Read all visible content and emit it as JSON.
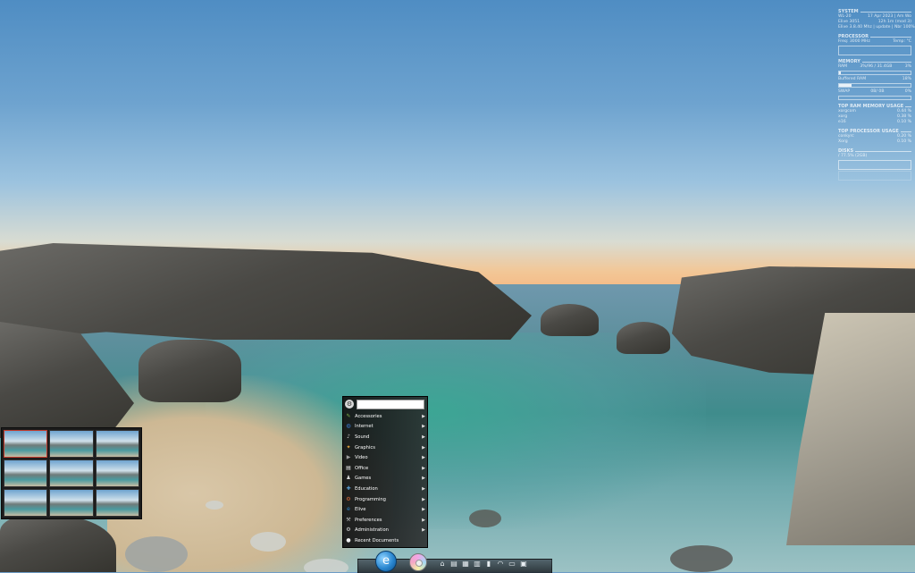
{
  "conky": {
    "system": {
      "title": "SYSTEM",
      "host": "WL-20",
      "date": "17 Apr 2023 | Am Wo",
      "kernel": "Elive 3051",
      "uptime": "12h 1m (mod 3)",
      "cpu_info": "Elive 3.8.40 Mhz | update | Nbr 100%"
    },
    "processor": {
      "title": "PROCESSOR",
      "freq": "Freq: 3000 MHz",
      "temp": "Temp: °C"
    },
    "memory": {
      "title": "MEMORY",
      "ram": "RAM",
      "ram_value": "3%/96 / 31.4GB",
      "ram_pct": "3%",
      "ram_fill": 0.03,
      "buffered": "Buffered RAM",
      "buffered_pct": "18%",
      "buffered_fill": 0.18,
      "swap": "SWAP",
      "swap_value": "0B/ 0B",
      "swap_pct": "0%",
      "swap_fill": 0
    },
    "top_mem": {
      "title": "TOP RAM MEMORY USAGE",
      "rows": [
        {
          "name": "xorgcom",
          "value": "0.44 %"
        },
        {
          "name": "xorg",
          "value": "0.38 %"
        },
        {
          "name": "e16",
          "value": "0.10 %"
        }
      ]
    },
    "top_cpu": {
      "title": "TOP PROCESSOR USAGE",
      "rows": [
        {
          "name": "conkyrc",
          "value": "0.20 %"
        },
        {
          "name": "Xorg",
          "value": "0.10 %"
        }
      ]
    },
    "disks": {
      "title": "DISKS",
      "root": "/ 77.5% (2GB)"
    }
  },
  "menu": {
    "search_placeholder": "",
    "items": [
      {
        "label": "Accessories",
        "icon": "accessories-icon",
        "glyph": "✎",
        "color": "#7fb24a"
      },
      {
        "label": "Internet",
        "icon": "internet-globe-icon",
        "glyph": "◍",
        "color": "#3a7bd5"
      },
      {
        "label": "Sound",
        "icon": "sound-icon",
        "glyph": "♪",
        "color": "#c9c9c9"
      },
      {
        "label": "Graphics",
        "icon": "graphics-icon",
        "glyph": "✦",
        "color": "#e0a13a"
      },
      {
        "label": "Video",
        "icon": "video-icon",
        "glyph": "▶",
        "color": "#9a9a9a"
      },
      {
        "label": "Office",
        "icon": "office-icon",
        "glyph": "▤",
        "color": "#e8e8e8"
      },
      {
        "label": "Games",
        "icon": "games-icon",
        "glyph": "♟",
        "color": "#d8d8d8"
      },
      {
        "label": "Education",
        "icon": "education-icon",
        "glyph": "✚",
        "color": "#5aa0d8"
      },
      {
        "label": "Programming",
        "icon": "programming-icon",
        "glyph": "⚙",
        "color": "#d86a3a"
      },
      {
        "label": "Elive",
        "icon": "elive-icon",
        "glyph": "e",
        "color": "#2a87d0"
      },
      {
        "label": "Preferences",
        "icon": "preferences-icon",
        "glyph": "⚒",
        "color": "#bdbdbd"
      },
      {
        "label": "Administration",
        "icon": "administration-icon",
        "glyph": "⚙",
        "color": "#dcdcdc"
      },
      {
        "label": "Recent Documents",
        "icon": "recent-documents-icon",
        "glyph": "●",
        "color": "#eeeeee"
      }
    ]
  },
  "pager": {
    "workspaces": 9,
    "active": 0
  },
  "dock": {
    "launcher_glyph": "e",
    "icons": [
      {
        "name": "home-folder-icon",
        "glyph": "⌂"
      },
      {
        "name": "text-editor-icon",
        "glyph": "▤"
      },
      {
        "name": "file-manager-icon",
        "glyph": "▦"
      },
      {
        "name": "document-icon",
        "glyph": "▥"
      },
      {
        "name": "terminal-icon",
        "glyph": "▮"
      },
      {
        "name": "network-wifi-icon",
        "glyph": "◠"
      },
      {
        "name": "monitor-icon",
        "glyph": "▭"
      },
      {
        "name": "image-viewer-icon",
        "glyph": "▣"
      }
    ]
  }
}
